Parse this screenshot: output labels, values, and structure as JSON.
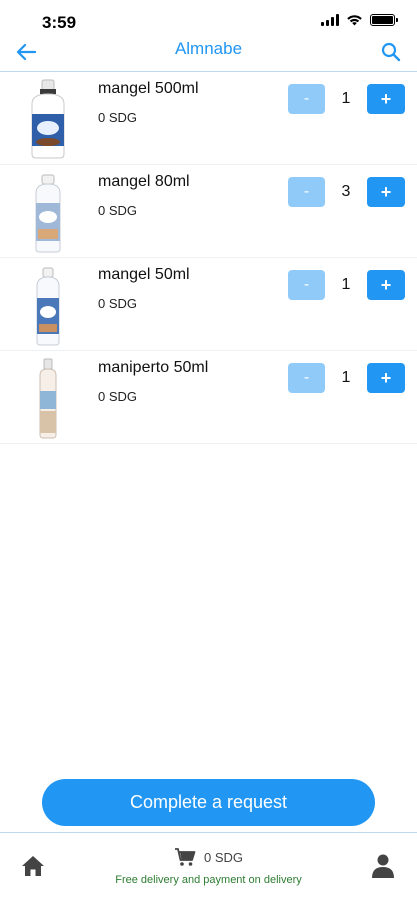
{
  "status_bar": {
    "time": "3:59"
  },
  "header": {
    "title": "Almnabe"
  },
  "products": [
    {
      "name": "mangel 500ml",
      "price": "0 SDG",
      "quantity": "1",
      "minus_label": "-",
      "plus_label": "+"
    },
    {
      "name": "mangel 80ml",
      "price": "0 SDG",
      "quantity": "3",
      "minus_label": "-",
      "plus_label": "+"
    },
    {
      "name": "mangel 50ml",
      "price": "0 SDG",
      "quantity": "1",
      "minus_label": "-",
      "plus_label": "+"
    },
    {
      "name": "maniperto 50ml",
      "price": "0 SDG",
      "quantity": "1",
      "minus_label": "-",
      "plus_label": "+"
    }
  ],
  "actions": {
    "complete_label": "Complete a request"
  },
  "footer": {
    "cart_total": "0 SDG",
    "delivery_note": "Free delivery and payment on delivery",
    "icons": {
      "home": "home-icon",
      "cart": "cart-icon",
      "profile": "profile-icon"
    }
  },
  "colors": {
    "accent": "#2196f3",
    "accent_light": "#90caf9",
    "note_green": "#2e7d32",
    "divider": "#bcd9f2"
  }
}
